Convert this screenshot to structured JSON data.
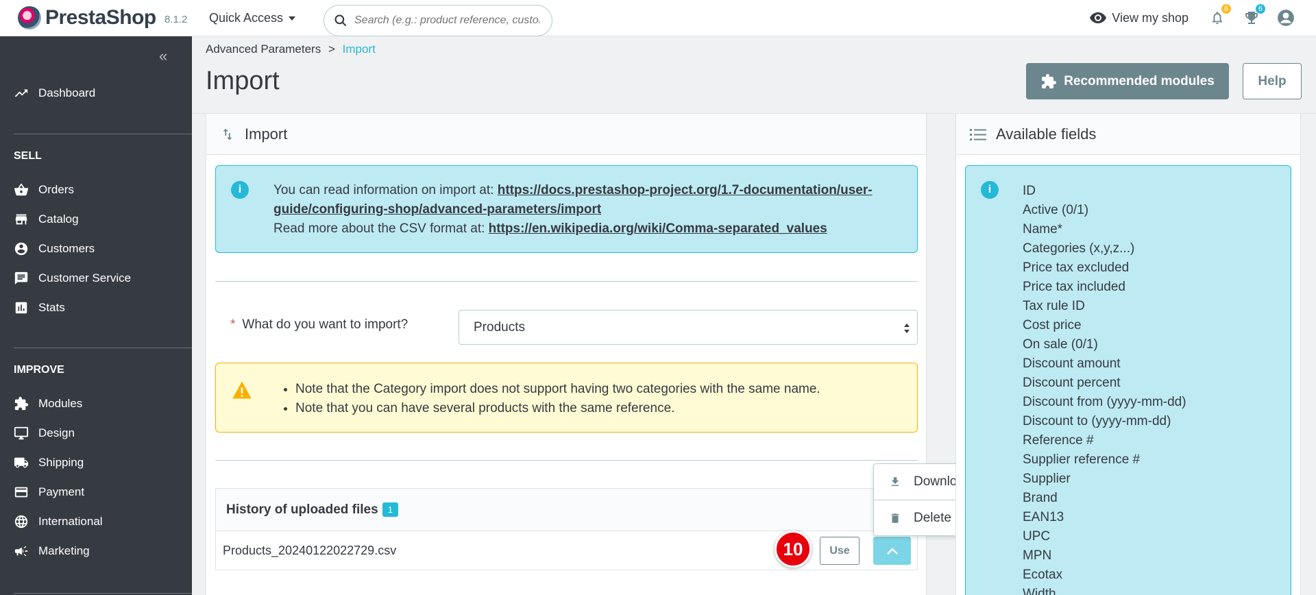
{
  "header": {
    "logo_text": "PrestaShop",
    "version": "8.1.2",
    "quick_access": "Quick Access",
    "search_placeholder": "Search (e.g.: product reference, custon",
    "view_shop": "View my shop",
    "notifications_count": "6",
    "trophy_count": "6",
    "colors": {
      "notif_badge": "#fbbb22",
      "trophy_badge": "#25b9d7"
    }
  },
  "sidebar": {
    "dashboard": "Dashboard",
    "sections": [
      {
        "title": "SELL",
        "items": [
          "Orders",
          "Catalog",
          "Customers",
          "Customer Service",
          "Stats"
        ]
      },
      {
        "title": "IMPROVE",
        "items": [
          "Modules",
          "Design",
          "Shipping",
          "Payment",
          "International",
          "Marketing"
        ]
      }
    ]
  },
  "breadcrumb": {
    "parent": "Advanced Parameters",
    "separator": ">",
    "current": "Import"
  },
  "page": {
    "title": "Import",
    "recommended_modules": "Recommended modules",
    "help": "Help"
  },
  "import_card": {
    "title": "Import",
    "info_prefix": "You can read information on import at: ",
    "info_link": "https://docs.prestashop-project.org/1.7-documentation/user-guide/configuring-shop/advanced-parameters/import",
    "csv_prefix": "Read more about the CSV format at: ",
    "csv_link": "https://en.wikipedia.org/wiki/Comma-separated_values",
    "question_required": "*",
    "question": "What do you want to import?",
    "selected_entity": "Products",
    "warnings": [
      "Note that the Category import does not support having two categories with the same name.",
      "Note that you can have several products with the same reference."
    ],
    "history_title": "History of uploaded files",
    "history_count": "1",
    "file_name": "Products_20240122022729.csv",
    "step_badge": "10",
    "use_button": "Use",
    "dropdown": {
      "download": "Download",
      "delete": "Delete"
    }
  },
  "fields_card": {
    "title": "Available fields",
    "fields": [
      "ID",
      "Active (0/1)",
      "Name*",
      "Categories (x,y,z...)",
      "Price tax excluded",
      "Price tax included",
      "Tax rule ID",
      "Cost price",
      "On sale (0/1)",
      "Discount amount",
      "Discount percent",
      "Discount from (yyyy-mm-dd)",
      "Discount to (yyyy-mm-dd)",
      "Reference #",
      "Supplier reference #",
      "Supplier",
      "Brand",
      "EAN13",
      "UPC",
      "MPN",
      "Ecotax",
      "Width"
    ]
  }
}
